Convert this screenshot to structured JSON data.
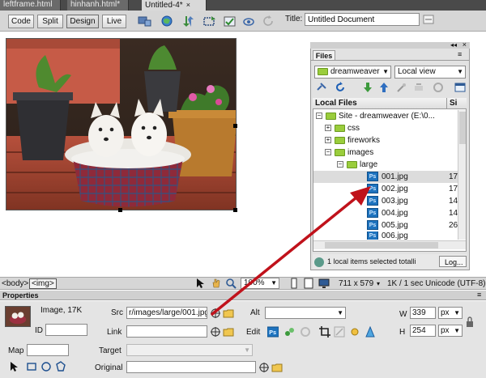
{
  "tabs": [
    {
      "label": "leftframe.html",
      "close": ""
    },
    {
      "label": "hinhanh.html*",
      "close": ""
    },
    {
      "label": "Untitled-4*",
      "close": "×"
    }
  ],
  "toolbar": {
    "code_label": "Code",
    "split_label": "Split",
    "design_label": "Design",
    "live_label": "Live",
    "title_label": "Title:",
    "title_value": "Untitled Document"
  },
  "files": {
    "tab_label": "Files",
    "site_select": "dreamweaver",
    "view_select": "Local view",
    "col_local": "Local Files",
    "col_size": "Si",
    "tree": [
      {
        "label": "Site - dreamweaver (E:\\0...",
        "size": ""
      },
      {
        "label": "css",
        "size": ""
      },
      {
        "label": "fireworks",
        "size": ""
      },
      {
        "label": "images",
        "size": ""
      },
      {
        "label": "large",
        "size": ""
      }
    ],
    "files": [
      {
        "name": "001.jpg",
        "size": "17"
      },
      {
        "name": "002.jpg",
        "size": "17"
      },
      {
        "name": "003.jpg",
        "size": "14"
      },
      {
        "name": "004.jpg",
        "size": "14"
      },
      {
        "name": "005.jpg",
        "size": "26"
      },
      {
        "name": "006.jpg",
        "size": ""
      }
    ],
    "status_text": "1 local items selected totalli",
    "log_label": "Log..."
  },
  "statusbar": {
    "tag_body": "<body>",
    "tag_img": "<img>",
    "zoom": "100%",
    "dimensions": "711 x 579",
    "download": "1K / 1 sec",
    "encoding": "Unicode (UTF-8)"
  },
  "properties": {
    "title": "Properties",
    "type_label": "Image, 17K",
    "id_label": "ID",
    "src_label": "Src",
    "src_value": "r/images/large/001.jpg",
    "link_label": "Link",
    "alt_label": "Alt",
    "edit_label": "Edit",
    "w_label": "W",
    "w_value": "339",
    "h_label": "H",
    "h_value": "254",
    "unit": "px",
    "map_label": "Map",
    "target_label": "Target",
    "original_label": "Original"
  },
  "colors": {
    "arrow": "#c0121b",
    "accent_ps": "#1e73be",
    "folder": "#9acd3c"
  }
}
